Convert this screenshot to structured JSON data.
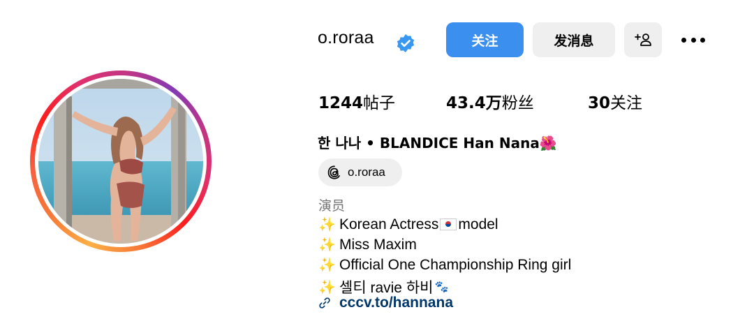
{
  "profile": {
    "username": "o.roraa",
    "full_name": "한 나나 • BLANDICE Han Nana",
    "name_emoji": "🌺",
    "threads_handle": "o.roraa",
    "category": "演员"
  },
  "actions": {
    "follow_label": "关注",
    "message_label": "发消息"
  },
  "stats": {
    "posts_value": "1244",
    "posts_label": "帖子",
    "followers_value": "43.4万",
    "followers_label": "粉丝",
    "following_value": "30",
    "following_label": "关注"
  },
  "bio": {
    "spark": "✨",
    "line1_a": "Korean Actress",
    "line1_b": "model",
    "line2": "Miss Maxim",
    "line3": "Official One Championship Ring girl",
    "line4": "셀티 ravie 하비",
    "line4_emoji": "🐾",
    "link": "cccv.to/hannana"
  },
  "colors": {
    "follow_button": "#3b8fef",
    "secondary_button": "#efefef",
    "verified_badge": "#3897f0",
    "link_text": "#00376b",
    "category_text": "#737373"
  },
  "icons": [
    "verified-badge-icon",
    "add-user-icon",
    "more-options-icon",
    "threads-icon",
    "sparkles-icon",
    "korea-flag-icon",
    "paw-prints-icon",
    "link-icon"
  ]
}
